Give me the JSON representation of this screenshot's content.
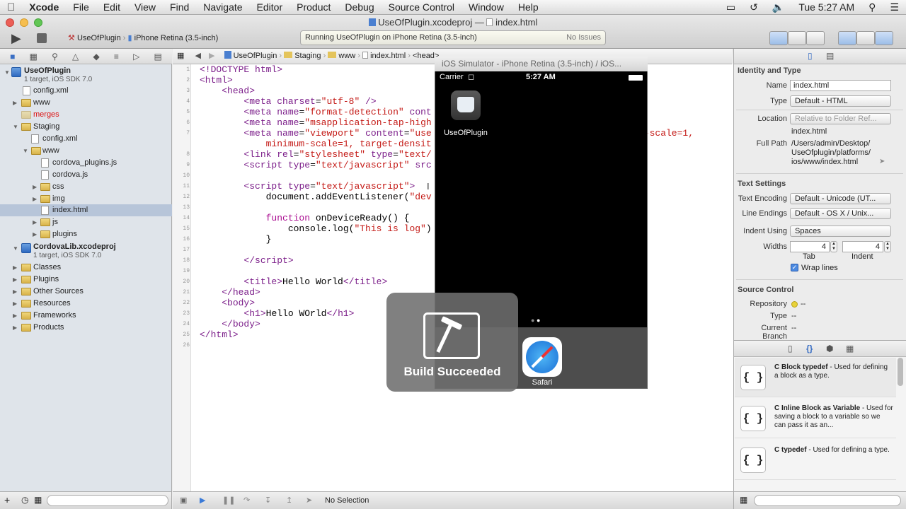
{
  "menubar": {
    "apple": "",
    "app": "Xcode",
    "items": [
      "File",
      "Edit",
      "View",
      "Find",
      "Navigate",
      "Editor",
      "Product",
      "Debug",
      "Source Control",
      "Window",
      "Help"
    ],
    "clock": "Tue 5:27 AM"
  },
  "window": {
    "title_project": "UseOfPlugin.xcodeproj",
    "title_sep": "—",
    "title_file": "index.html"
  },
  "toolbar": {
    "scheme": "UseOfPlugin",
    "device": "iPhone Retina (3.5-inch)",
    "status": "Running UseOfPlugin on iPhone Retina (3.5-inch)",
    "issues": "No Issues"
  },
  "navigator": {
    "project_name": "UseOfPlugin",
    "project_sub": "1 target, iOS SDK 7.0",
    "items": [
      {
        "label": "config.xml"
      },
      {
        "label": "www"
      },
      {
        "label": "merges"
      },
      {
        "label": "Staging"
      },
      {
        "label": "config.xml"
      },
      {
        "label": "www"
      },
      {
        "label": "cordova_plugins.js"
      },
      {
        "label": "cordova.js"
      },
      {
        "label": "css"
      },
      {
        "label": "img"
      },
      {
        "label": "index.html"
      },
      {
        "label": "js"
      },
      {
        "label": "plugins"
      }
    ],
    "lib_name": "CordovaLib.xcodeproj",
    "lib_sub": "1 target, iOS SDK 7.0",
    "groups": [
      "Classes",
      "Plugins",
      "Other Sources",
      "Resources",
      "Frameworks",
      "Products"
    ]
  },
  "jumpbar": [
    "UseOfPlugin",
    "Staging",
    "www",
    "index.html",
    "<head>"
  ],
  "editor": {
    "line_numbers": [
      "1",
      "2",
      "3",
      "4",
      "5",
      "6",
      "7",
      "",
      "8",
      "9",
      "10",
      "11",
      "12",
      "13",
      "14",
      "15",
      "16",
      "17",
      "18",
      "19",
      "20",
      "21",
      "22",
      "23",
      "24",
      "25",
      "26"
    ]
  },
  "bottom": {
    "selection": "No Selection"
  },
  "simulator": {
    "title": "iOS Simulator - iPhone Retina (3.5-inch) / iOS...",
    "carrier": "Carrier",
    "time": "5:27 AM",
    "app_label": "UseOfPlugin",
    "dock_app": "Safari"
  },
  "hud": {
    "text": "Build Succeeded"
  },
  "inspector": {
    "identity_title": "Identity and Type",
    "name_label": "Name",
    "name_value": "index.html",
    "type_label": "Type",
    "type_value": "Default - HTML",
    "location_label": "Location",
    "location_value": "Relative to Folder Ref...",
    "location_file": "index.html",
    "fullpath_label": "Full Path",
    "fullpath_value": [
      "/Users/admin/Desktop/",
      "UseOfplugin/platforms/",
      "ios/www/index.html"
    ],
    "text_title": "Text Settings",
    "enc_label": "Text Encoding",
    "enc_value": "Default - Unicode (UT...",
    "endings_label": "Line Endings",
    "endings_value": "Default - OS X / Unix...",
    "indent_label": "Indent Using",
    "indent_value": "Spaces",
    "widths_label": "Widths",
    "tab_value": "4",
    "indent_value2": "4",
    "tab_label": "Tab",
    "indent_label2": "Indent",
    "wrap_label": "Wrap lines",
    "sc_title": "Source Control",
    "repo_label": "Repository",
    "repo_value": "--",
    "sctype_label": "Type",
    "sctype_value": "--",
    "branch_label": "Current Branch",
    "branch_value": "--"
  },
  "library": [
    {
      "icon": "{ }",
      "title": "C Block typedef",
      "desc": " - Used for defining a block as a type."
    },
    {
      "icon": "{ }",
      "title": "C Inline Block as Variable",
      "desc": " - Used for saving a block to a variable so we can pass it as an..."
    },
    {
      "icon": "{ }",
      "title": "C typedef",
      "desc": " - Used for defining a type."
    }
  ]
}
